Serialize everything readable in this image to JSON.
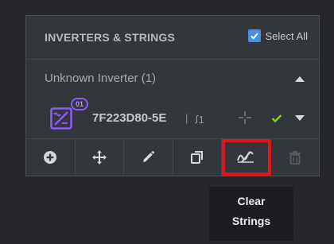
{
  "panel": {
    "title": "INVERTERS & STRINGS",
    "select_all_label": "Select All",
    "select_all_checked": true
  },
  "group": {
    "label": "Unknown Inverter (1)"
  },
  "inverter": {
    "badge": "01",
    "name": "7F223D80-5E",
    "separator": "|",
    "string_count": "ꭍ1",
    "check_color": "#7ed321"
  },
  "toolbar": {
    "buttons": [
      {
        "icon": "add-circle-icon"
      },
      {
        "icon": "move-icon"
      },
      {
        "icon": "pencil-icon"
      },
      {
        "icon": "copy-icon"
      },
      {
        "icon": "clear-strings-icon",
        "highlighted": true
      },
      {
        "icon": "trash-icon",
        "disabled": true
      }
    ]
  },
  "tooltip": {
    "line1": "Clear",
    "line2": "Strings"
  },
  "colors": {
    "accent": "#4a90e2",
    "badge": "#8b5cf6",
    "highlight": "#e0151c"
  }
}
